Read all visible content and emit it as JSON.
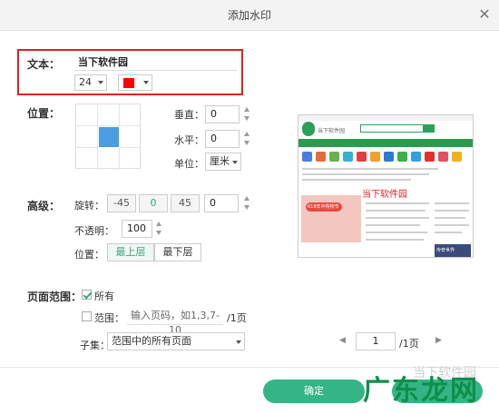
{
  "dialog": {
    "title": "添加水印",
    "close_glyph": "✕"
  },
  "text_section": {
    "label": "文本：",
    "value": "当下软件园",
    "font_size": "24",
    "color": "#ff0000"
  },
  "position_section": {
    "label": "位置：",
    "selected_cell": "center",
    "vertical_label": "垂直：",
    "vertical_value": "0",
    "horizontal_label": "水平：",
    "horizontal_value": "0",
    "unit_label": "单位：",
    "unit_value": "厘米"
  },
  "advanced_section": {
    "label": "高级：",
    "rotation_label": "旋转：",
    "rotation_presets": [
      "-45",
      "0",
      "45"
    ],
    "rotation_value": "0",
    "opacity_label": "不透明：",
    "opacity_value": "100",
    "layer_label": "位置：",
    "layer_top": "最上层",
    "layer_bottom": "最下层"
  },
  "page_range": {
    "label": "页面范围：",
    "all_label": "所有",
    "all_checked": true,
    "range_label": "范围：",
    "range_checked": false,
    "range_placeholder": "输入页码，如1,3,7-10",
    "range_total": "/1页",
    "subset_label": "子集：",
    "subset_value": "范围中的所有页面"
  },
  "pager": {
    "prev": "◀",
    "next": "▶",
    "current": "1",
    "total": "/1页"
  },
  "preview": {
    "site_title": "当下软件园",
    "watermark_text": "当下软件园",
    "banner_text": "618年中购物节",
    "game_text": "传奇世界"
  },
  "footer": {
    "ok_label": "确定",
    "watermark_brand": "广东龙网",
    "watermark_sub": "当下软件园"
  },
  "colors": {
    "accent": "#35b585",
    "highlight_border": "#e02020",
    "selected_cell": "#4a9de0"
  }
}
